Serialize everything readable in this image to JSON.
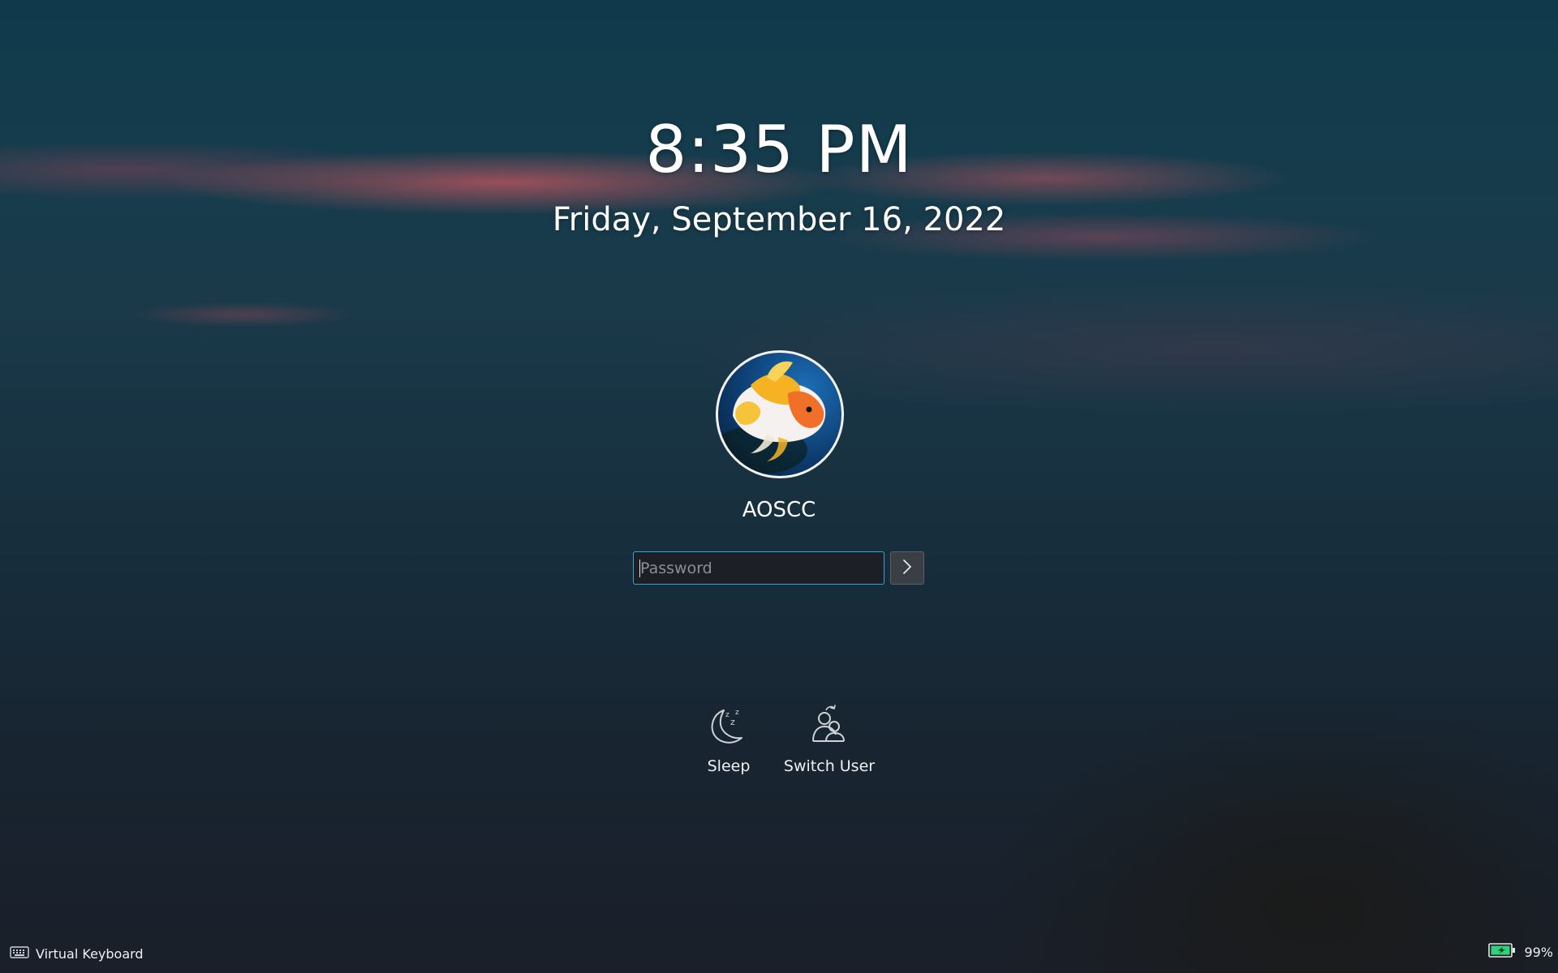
{
  "lockscreen": {
    "time": "8:35 PM",
    "date": "Friday, September 16, 2022",
    "user": {
      "name": "AOSCC",
      "avatar_icon": "goldfish-avatar"
    },
    "password": {
      "placeholder": "Password",
      "value": ""
    },
    "submit": {
      "icon": "chevron-right-icon"
    },
    "actions": [
      {
        "label": "Sleep",
        "icon": "sleep-moon-icon"
      },
      {
        "label": "Switch User",
        "icon": "switch-user-icon"
      }
    ]
  },
  "footer": {
    "virtual_keyboard_label": "Virtual Keyboard",
    "battery_percent": "99%"
  },
  "colors": {
    "accent": "#3d9fd6",
    "battery": "#2fd17a"
  }
}
